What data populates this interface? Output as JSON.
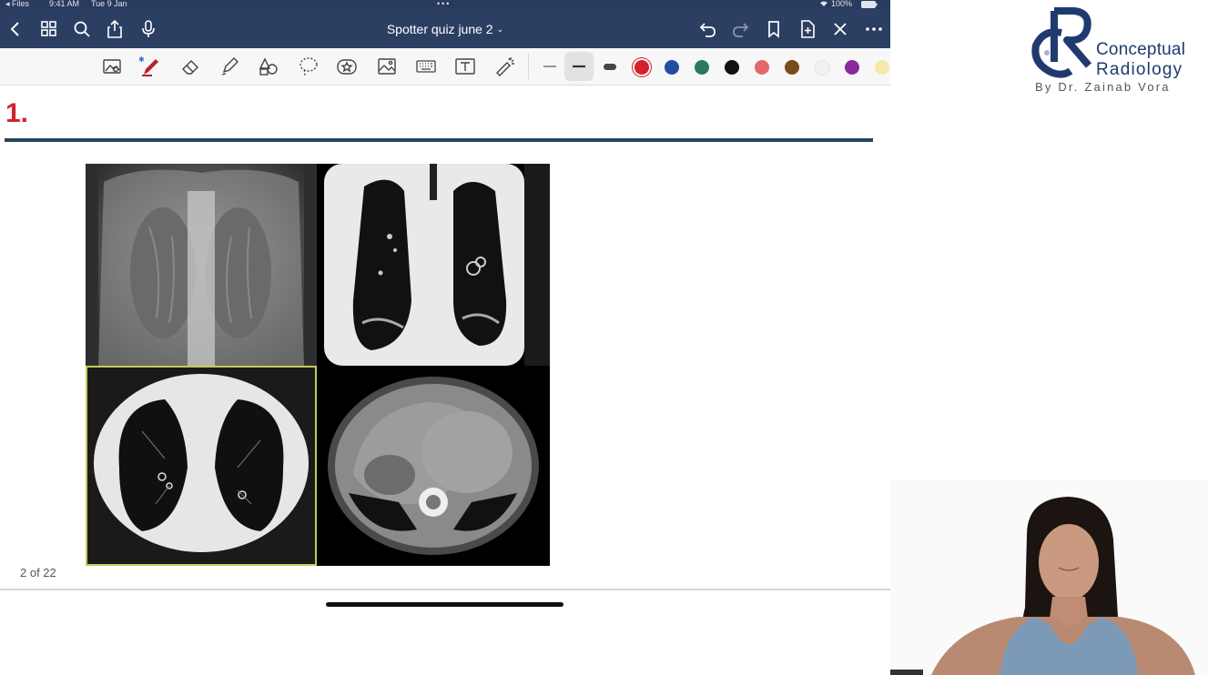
{
  "status_bar": {
    "back_app": "◂ Files",
    "time": "9:41 AM",
    "date": "Tue 9 Jan",
    "battery": "100%"
  },
  "nav": {
    "title": "Spotter quiz june 2"
  },
  "toolbar": {
    "tools": [
      "scan-icon",
      "pen-icon",
      "eraser-icon",
      "highlighter-icon",
      "shapes-icon",
      "lasso-icon",
      "sticker-icon",
      "image-icon",
      "keyboard-icon",
      "text-box-icon",
      "laser-pointer-icon"
    ],
    "line_widths": [
      "thin",
      "medium",
      "thick"
    ],
    "colors": [
      "#d4212b",
      "#1f4ea1",
      "#2a7a5a",
      "#111111",
      "#e06a6a",
      "#7a4a1a",
      "#f2f2f2",
      "#8a2a9e",
      "#f3e9a8"
    ]
  },
  "page": {
    "question_number": "1.",
    "page_indicator": "2 of 22"
  },
  "figure": {
    "panels": [
      "chest-radiograph-panel",
      "coronal-ct-panel",
      "axial-ct-lung-window-panel",
      "axial-ct-abdomen-panel"
    ]
  },
  "brand": {
    "line1": "Conceptual",
    "line2": "Radiology",
    "line3": "By Dr. Zainab Vora",
    "color": "#1f3a6e"
  }
}
